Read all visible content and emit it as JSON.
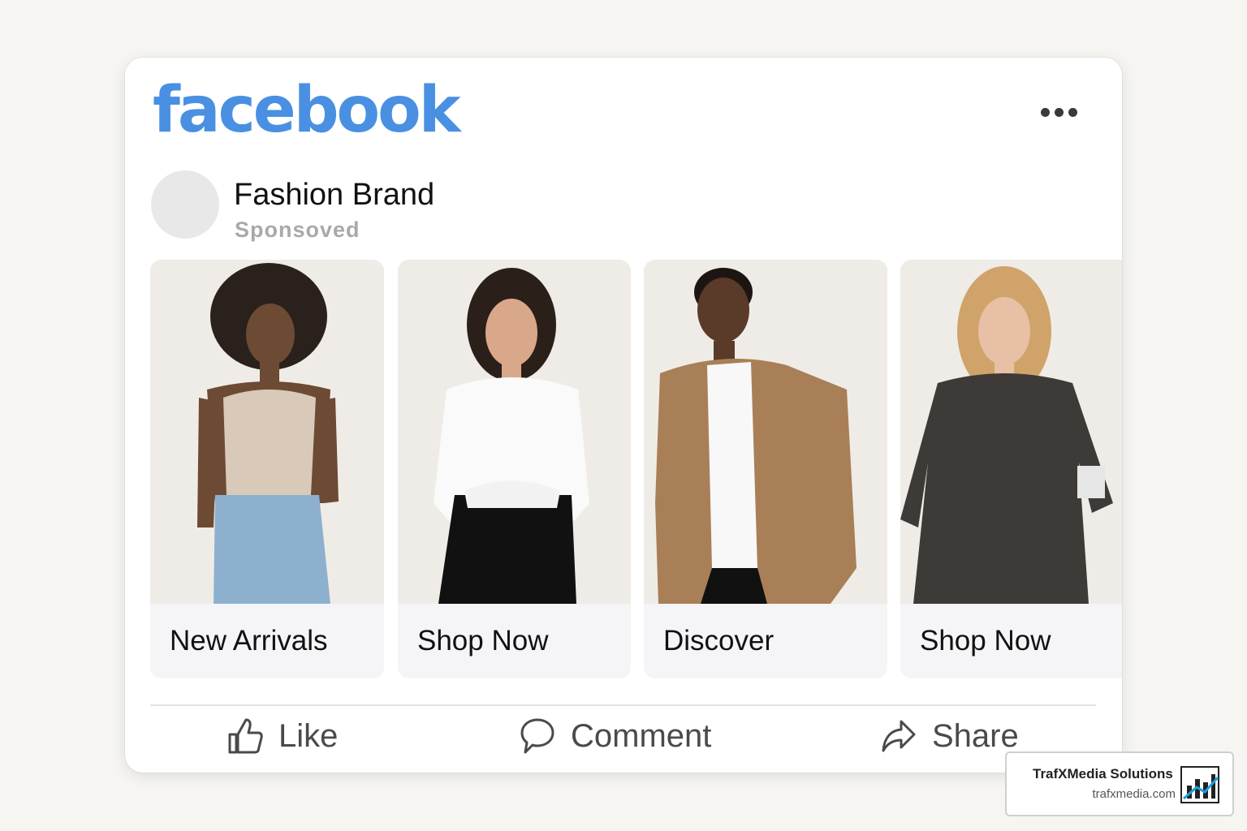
{
  "post": {
    "platform_logo": "facebook",
    "menu_icon": "more-options-icon",
    "page_name": "Fashion Brand",
    "sponsored_label": "Sponsoved"
  },
  "carousel": {
    "items": [
      {
        "caption": "New Arrivals",
        "image": "model-tank-top-jeans"
      },
      {
        "caption": "Shop Now",
        "image": "model-white-shirt-black-pants"
      },
      {
        "caption": "Discover",
        "image": "model-tan-blazer"
      },
      {
        "caption": "Shop Now",
        "image": "model-speckled-dress"
      }
    ]
  },
  "actions": {
    "like": "Like",
    "comment": "Comment",
    "share": "Share"
  },
  "watermark": {
    "name": "TrafXMedia Solutions",
    "url": "trafxmedia.com"
  },
  "colors": {
    "brand_blue": "#4a90e2",
    "background": "#f6f5f2",
    "card": "#ffffff",
    "caption_bg": "#f5f5f8"
  }
}
